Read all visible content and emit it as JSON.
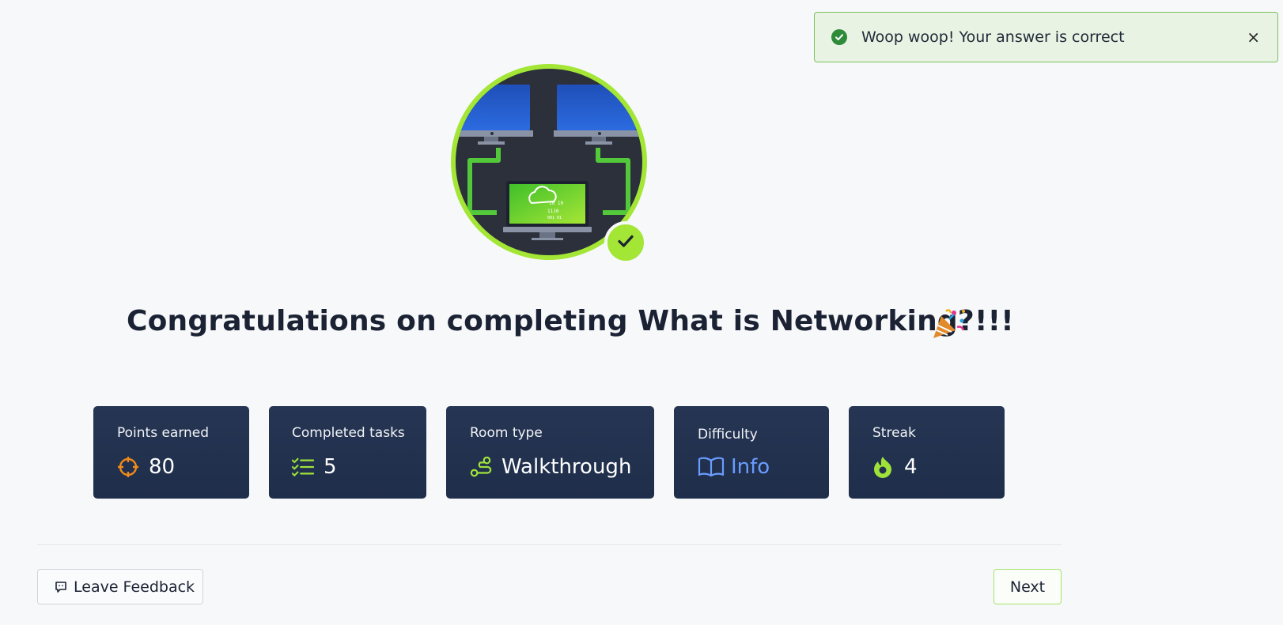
{
  "toast": {
    "message": "Woop woop! Your answer is correct",
    "close_symbol": "×",
    "icon": "check-circle-icon"
  },
  "room": {
    "icon": "networking-room-icon",
    "completed_badge_icon": "check-icon"
  },
  "headline": {
    "text": "Congratulations on completing What is Networking?!!!",
    "emoji_icon": "party-popper-icon"
  },
  "stats": {
    "points": {
      "label": "Points earned",
      "value": "80",
      "icon": "crosshair-icon",
      "color": "#f08a1a"
    },
    "tasks": {
      "label": "Completed tasks",
      "value": "5",
      "icon": "checklist-icon",
      "color": "#9fe23a"
    },
    "room_type": {
      "label": "Room type",
      "value": "Walkthrough",
      "icon": "route-icon",
      "color": "#9fe23a"
    },
    "difficulty": {
      "label": "Difficulty",
      "value": "Info",
      "icon": "book-icon",
      "color": "#6a9cff"
    },
    "streak": {
      "label": "Streak",
      "value": "4",
      "icon": "flame-icon",
      "color": "#9fe23a"
    }
  },
  "footer": {
    "feedback_label": "Leave Feedback",
    "feedback_icon": "feedback-icon",
    "next_label": "Next"
  },
  "colors": {
    "accent": "#a3e635",
    "card_bg": "#22314e",
    "toast_border": "#7cc15a"
  }
}
